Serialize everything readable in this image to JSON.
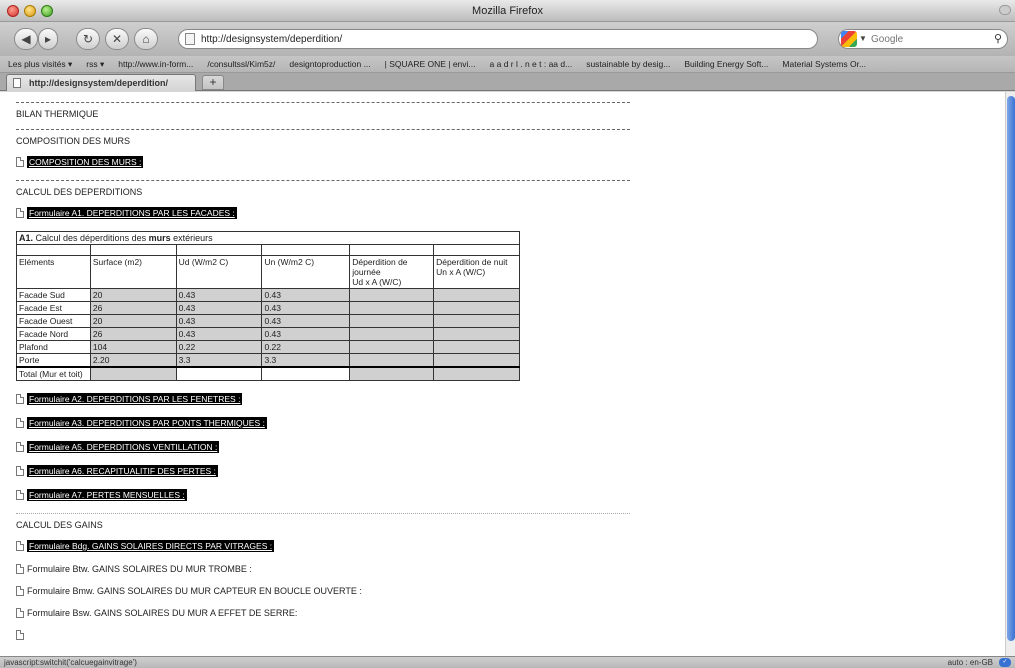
{
  "window": {
    "title": "Mozilla Firefox"
  },
  "nav": {
    "url": "http://designsystem/deperdition/",
    "search_placeholder": "Google"
  },
  "bookmarks": [
    "Les plus visités ▾",
    "rss ▾",
    "http://www.in-form...",
    "/consultssl/Kim5z/",
    "designtoproduction ...",
    "| SQUARE ONE | envi...",
    "a a d r l . n e t : aa d...",
    "sustainable by desig...",
    "Building Energy Soft...",
    "Material Systems Or..."
  ],
  "tab": {
    "label": "http://designsystem/deperdition/"
  },
  "page": {
    "bilan": "BILAN THERMIQUE",
    "composition_title": "COMPOSITION DES MURS",
    "composition_link": "COMPOSITION DES MURS :",
    "calcul_title": "CALCUL DES DEPERDITIONS",
    "link_a1": "Formulaire A1. DEPERDITIONS PAR LES FACADES :",
    "table": {
      "caption_bold": "A1.",
      "caption_pre": " Calcul des déperditions des ",
      "caption_strong": "murs",
      "caption_post": " extérieurs",
      "headers": [
        "Eléments",
        "Surface (m2)",
        "Ud (W/m2 C)",
        "Un (W/m2 C)",
        "Déperdition de journée\nUd x A (W/C)",
        "Déperdition de nuit\nUn x A (W/C)"
      ],
      "rows": [
        [
          "Facade Sud",
          "20",
          "0.43",
          "0.43",
          "",
          ""
        ],
        [
          "Facade Est",
          "26",
          "0.43",
          "0.43",
          "",
          ""
        ],
        [
          "Facade Ouest",
          "20",
          "0.43",
          "0.43",
          "",
          ""
        ],
        [
          "Facade Nord",
          "26",
          "0.43",
          "0.43",
          "",
          ""
        ],
        [
          "Plafond",
          "104",
          "0.22",
          "0.22",
          "",
          ""
        ],
        [
          "Porte",
          "2.20",
          "3.3",
          "3.3",
          "",
          ""
        ]
      ],
      "total_label": "Total (Mur et toit)"
    },
    "links_deperditions": [
      "Formulaire A2. DEPERDITIONS PAR LES FENETRES :",
      "Formulaire A3. DEPERDITIONS PAR PONTS THERMIQUES :",
      "Formulaire A5. DEPERDITIONS VENTILLATION :",
      "Formulaire A6. RECAPITUALITIF DES PERTES :",
      "Formulaire A7. PERTES MENSUELLES :"
    ],
    "gains_title": "CALCUL DES GAINS",
    "link_bdg": "Formulaire Bdg. GAINS SOLAIRES DIRECTS PAR VITRAGES :",
    "links_gains_plain": [
      "Formulaire Btw. GAINS SOLAIRES DU MUR TROMBE :",
      "Formulaire Bmw. GAINS SOLAIRES DU MUR CAPTEUR EN BOUCLE OUVERTE :",
      "Formulaire Bsw. GAINS SOLAIRES DU MUR A EFFET DE SERRE:"
    ]
  },
  "status": {
    "text": "javascript:switchit('calcuegainvitrage')",
    "right": "auto : en-GB"
  }
}
